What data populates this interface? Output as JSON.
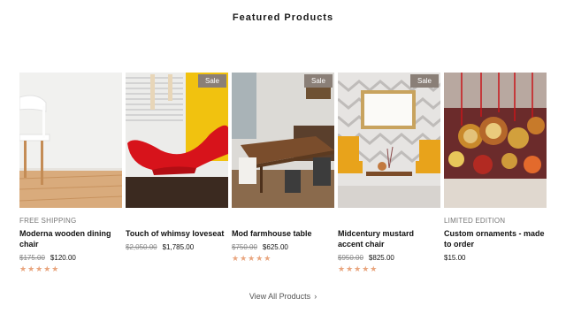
{
  "section": {
    "title": "Featured Products"
  },
  "products": [
    {
      "label": "FREE SHIPPING",
      "badge": "",
      "name": "Moderna wooden dining chair",
      "old_price": "$175.00",
      "price": "$120.00",
      "rating": 5,
      "stars": "★★★★★"
    },
    {
      "label": "",
      "badge": "Sale",
      "name": "Touch of whimsy loveseat",
      "old_price": "$2,050.00",
      "price": "$1,785.00",
      "rating": 0,
      "stars": ""
    },
    {
      "label": "",
      "badge": "Sale",
      "name": "Mod farmhouse table",
      "old_price": "$750.00",
      "price": "$625.00",
      "rating": 5,
      "stars": "★★★★★"
    },
    {
      "label": "",
      "badge": "Sale",
      "name": "Midcentury mustard accent chair",
      "old_price": "$950.00",
      "price": "$825.00",
      "rating": 5,
      "stars": "★★★★★"
    },
    {
      "label": "LIMITED EDITION",
      "badge": "",
      "name": "Custom ornaments - made to order",
      "old_price": "",
      "price": "$15.00",
      "rating": 0,
      "stars": ""
    }
  ],
  "first_badge": "Sale",
  "view_all": {
    "label": "View All Products",
    "icon": "chevron-right-icon"
  },
  "colors": {
    "badge": "#8a7f77",
    "stars": "#e9a57e"
  }
}
